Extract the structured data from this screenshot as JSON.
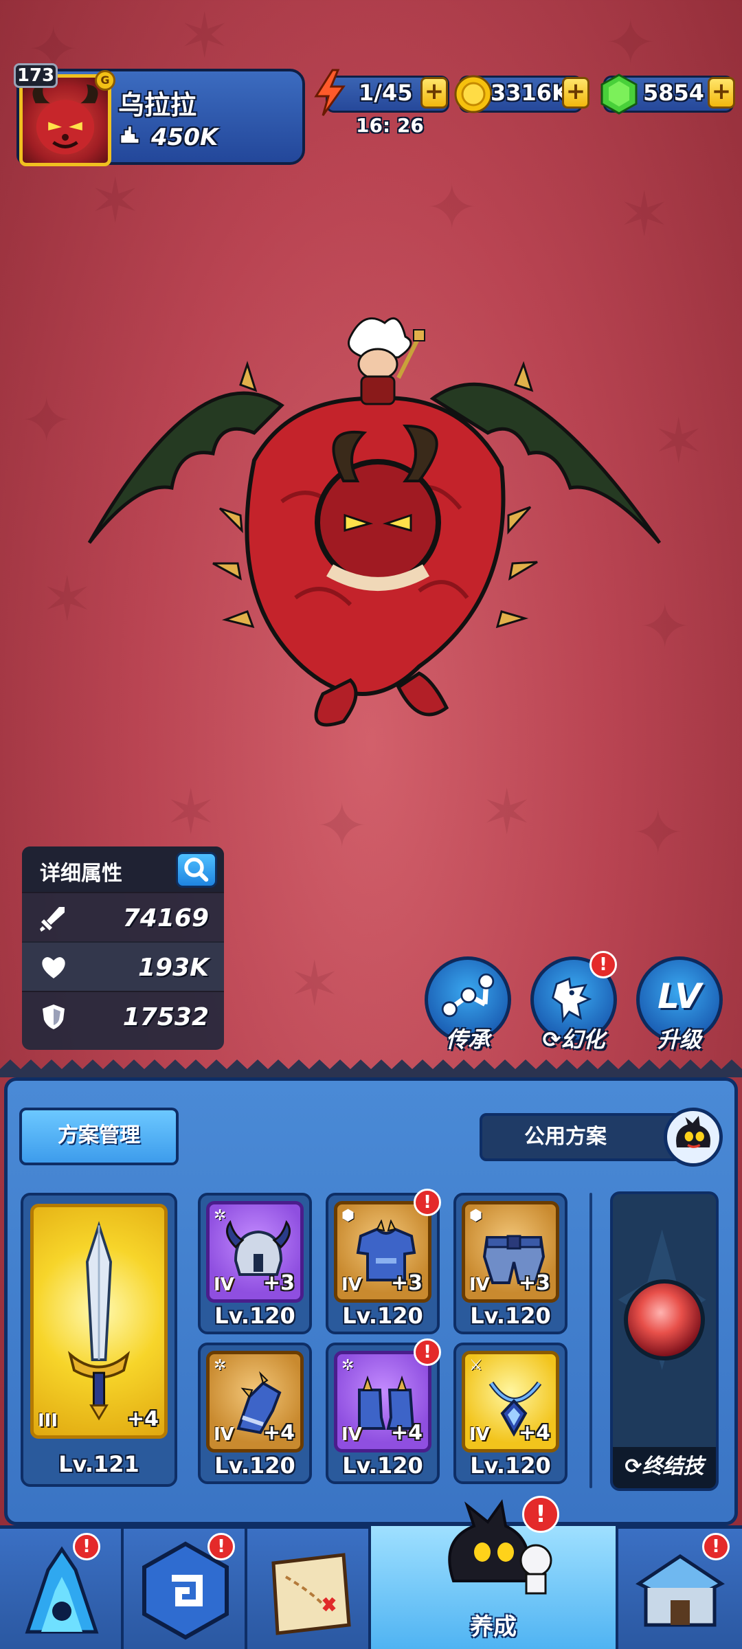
{
  "header": {
    "player_level": "173",
    "player_name": "乌拉拉",
    "player_power": "450K",
    "stamina": "1/45",
    "stamina_timer": "16: 26",
    "gold": "3316K",
    "gems": "5854",
    "plus_label": "+",
    "vip_label": "G"
  },
  "stats": {
    "title": "详细属性",
    "attack": "74169",
    "health": "193K",
    "defense": "17532"
  },
  "actions": {
    "inherit_label": "传承",
    "transform_label": "幻化",
    "upgrade_label": "升级",
    "upgrade_icon_text": "LV"
  },
  "equipment": {
    "plan_manage_label": "方案管理",
    "public_plan_label": "公用方案",
    "weapon": {
      "tier": "III",
      "plus": "+4",
      "level": "Lv.121"
    },
    "items": [
      {
        "slot": "helmet",
        "tier": "IV",
        "plus": "+3",
        "level": "Lv.120",
        "rarity": "purple"
      },
      {
        "slot": "armor",
        "tier": "IV",
        "plus": "+3",
        "level": "Lv.120",
        "rarity": "orange"
      },
      {
        "slot": "belt",
        "tier": "IV",
        "plus": "+3",
        "level": "Lv.120",
        "rarity": "orange"
      },
      {
        "slot": "gloves",
        "tier": "IV",
        "plus": "+4",
        "level": "Lv.120",
        "rarity": "orange"
      },
      {
        "slot": "boots",
        "tier": "IV",
        "plus": "+4",
        "level": "Lv.120",
        "rarity": "purple"
      },
      {
        "slot": "necklace",
        "tier": "IV",
        "plus": "+4",
        "level": "Lv.120",
        "rarity": "gold"
      }
    ],
    "ultimate_label": "终结技",
    "alert_mark": "!"
  },
  "nav": {
    "active_label": "养成"
  },
  "colors": {
    "background": "#b94452",
    "panel_blue": "#3a74c4",
    "accent_gold": "#f2c41c",
    "alert_red": "#e42a2a"
  }
}
